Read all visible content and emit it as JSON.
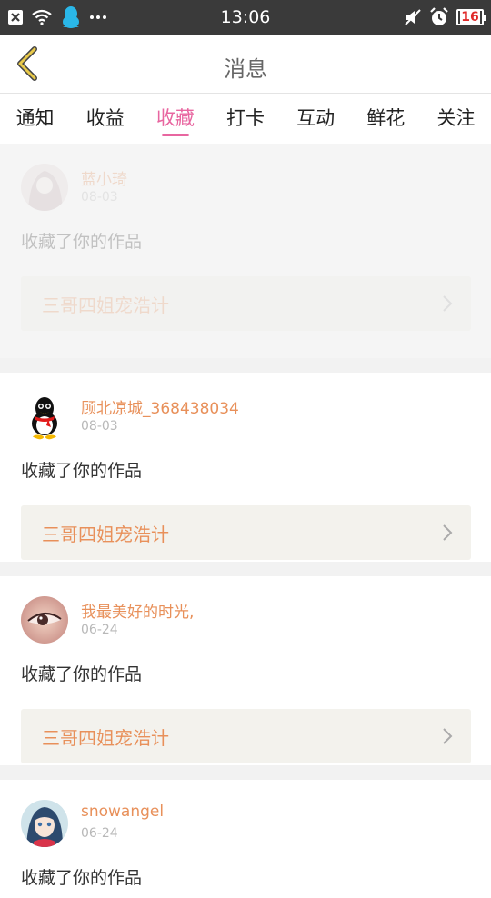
{
  "status_bar": {
    "time": "13:06",
    "battery": "16",
    "icons_left": [
      "close-box-icon",
      "wifi-icon",
      "qq-penguin-icon",
      "more-dots-icon"
    ],
    "icons_right": [
      "mute-icon",
      "alarm-icon",
      "battery-icon"
    ]
  },
  "header": {
    "title": "消息",
    "back_icon": "chevron-left-icon",
    "accent": "#e8c94a"
  },
  "tabs": [
    {
      "label": "通知",
      "active": false
    },
    {
      "label": "收益",
      "active": false
    },
    {
      "label": "收藏",
      "active": true
    },
    {
      "label": "打卡",
      "active": false
    },
    {
      "label": "互动",
      "active": false
    },
    {
      "label": "鲜花",
      "active": false
    },
    {
      "label": "关注",
      "active": false
    }
  ],
  "colors": {
    "active_tab": "#e866a0",
    "username": "#e8905a",
    "work_title": "#e8905a"
  },
  "notifications": [
    {
      "username": "蓝小琦",
      "date": "08-03",
      "action": "收藏了你的作品",
      "work": "三哥四姐宠浩计",
      "avatar": "anime-girl-avatar",
      "faded": true
    },
    {
      "username": "顾北凉城_368438034",
      "date": "08-03",
      "action": "收藏了你的作品",
      "work": "三哥四姐宠浩计",
      "avatar": "qq-penguin-avatar",
      "faded": false
    },
    {
      "username": "我最美好的时光,",
      "date": "06-24",
      "action": "收藏了你的作品",
      "work": "三哥四姐宠浩计",
      "avatar": "eye-closeup-avatar",
      "faded": false
    },
    {
      "username": "snowangel",
      "date": "06-24",
      "action": "收藏了你的作品",
      "work": "",
      "avatar": "anime-character-avatar",
      "faded": false
    }
  ]
}
